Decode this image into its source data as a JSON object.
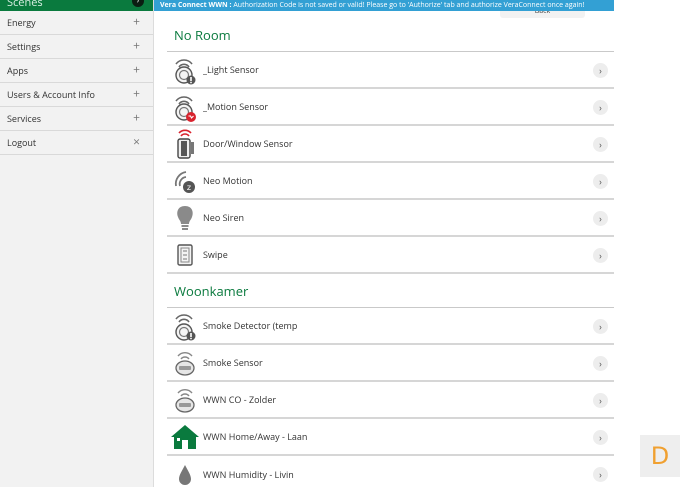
{
  "sidebar": {
    "top_label": "Scenes",
    "items": [
      {
        "label": "Energy",
        "sign": "+"
      },
      {
        "label": "Settings",
        "sign": "+"
      },
      {
        "label": "Apps",
        "sign": "+"
      },
      {
        "label": "Users & Account Info",
        "sign": "+"
      },
      {
        "label": "Services",
        "sign": "+"
      },
      {
        "label": "Logout",
        "sign": "×"
      }
    ]
  },
  "banner": {
    "bold": "Vera Connect WWN :",
    "text": " Authorization Code is not saved or valid! Please go to 'Authorize' tab and authorize VeraConnect once again!"
  },
  "back_label": "Back",
  "rooms": [
    {
      "title": "No Room",
      "devices": [
        {
          "name": "_Light Sensor",
          "icon": "light-sensor-icon"
        },
        {
          "name": "_Motion Sensor",
          "icon": "motion-sensor-alert-icon"
        },
        {
          "name": "Door/Window Sensor",
          "icon": "door-window-sensor-icon"
        },
        {
          "name": "Neo Motion",
          "icon": "motion-sensor-icon"
        },
        {
          "name": "Neo Siren",
          "icon": "siren-bulb-icon"
        },
        {
          "name": "Swipe",
          "icon": "swipe-device-icon"
        }
      ]
    },
    {
      "title": "Woonkamer",
      "devices": [
        {
          "name": "Smoke Detector (temp",
          "icon": "smoke-detector-icon"
        },
        {
          "name": "Smoke Sensor",
          "icon": "smoke-sensor-icon"
        },
        {
          "name": "WWN CO - Zolder",
          "icon": "co-sensor-icon"
        },
        {
          "name": "WWN Home/Away - Laan",
          "icon": "house-icon"
        },
        {
          "name": "WWN Humidity - Livin",
          "icon": "humidity-drop-icon"
        }
      ]
    }
  ],
  "chevron_glyph": "›",
  "badge_letter": "D",
  "colors": {
    "brand_green": "#0a7a3e",
    "banner_blue": "#33a0d4",
    "alert_red": "#d9232e",
    "badge_orange": "#f0a030"
  }
}
